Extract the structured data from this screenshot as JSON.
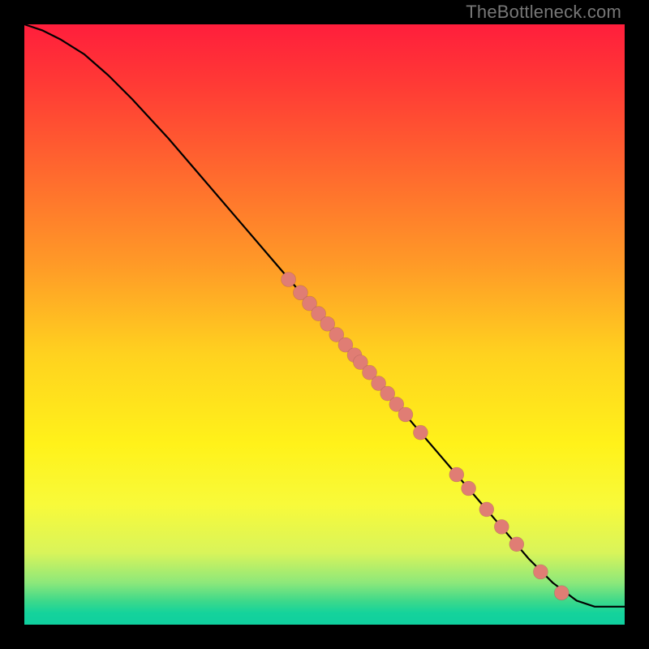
{
  "watermark": "TheBottleneck.com",
  "colors": {
    "frame": "#000000",
    "curve": "#000000",
    "dot_fill": "#e07d74",
    "gradient_top": "#ff1e3c",
    "gradient_bottom": "#0fcf9f"
  },
  "chart_data": {
    "type": "line",
    "title": "",
    "xlabel": "",
    "ylabel": "",
    "xlim": [
      0,
      100
    ],
    "ylim": [
      0,
      100
    ],
    "grid": false,
    "series": [
      {
        "name": "curve",
        "x": [
          0,
          3,
          6,
          10,
          14,
          18,
          24,
          30,
          36,
          42,
          48,
          54,
          60,
          66,
          72,
          78,
          84,
          88,
          92,
          95,
          100
        ],
        "y": [
          100,
          99,
          97.5,
          95,
          91.5,
          87.5,
          81,
          74,
          67,
          60,
          53,
          46,
          39,
          32,
          25,
          18,
          11,
          7,
          4,
          3,
          3
        ]
      }
    ],
    "points": [
      {
        "x": 44,
        "y": 57.5
      },
      {
        "x": 46,
        "y": 55.3
      },
      {
        "x": 47.5,
        "y": 53.5
      },
      {
        "x": 49,
        "y": 51.8
      },
      {
        "x": 50.5,
        "y": 50.1
      },
      {
        "x": 52,
        "y": 48.3
      },
      {
        "x": 53.5,
        "y": 46.6
      },
      {
        "x": 55,
        "y": 44.9
      },
      {
        "x": 56,
        "y": 43.7
      },
      {
        "x": 57.5,
        "y": 42
      },
      {
        "x": 59,
        "y": 40.2
      },
      {
        "x": 60.5,
        "y": 38.5
      },
      {
        "x": 62,
        "y": 36.7
      },
      {
        "x": 63.5,
        "y": 35
      },
      {
        "x": 66,
        "y": 32
      },
      {
        "x": 72,
        "y": 25
      },
      {
        "x": 74,
        "y": 22.7
      },
      {
        "x": 77,
        "y": 19.2
      },
      {
        "x": 79.5,
        "y": 16.3
      },
      {
        "x": 82,
        "y": 13.4
      },
      {
        "x": 86,
        "y": 8.8
      },
      {
        "x": 89.5,
        "y": 5.3
      }
    ],
    "point_radius": 9
  }
}
